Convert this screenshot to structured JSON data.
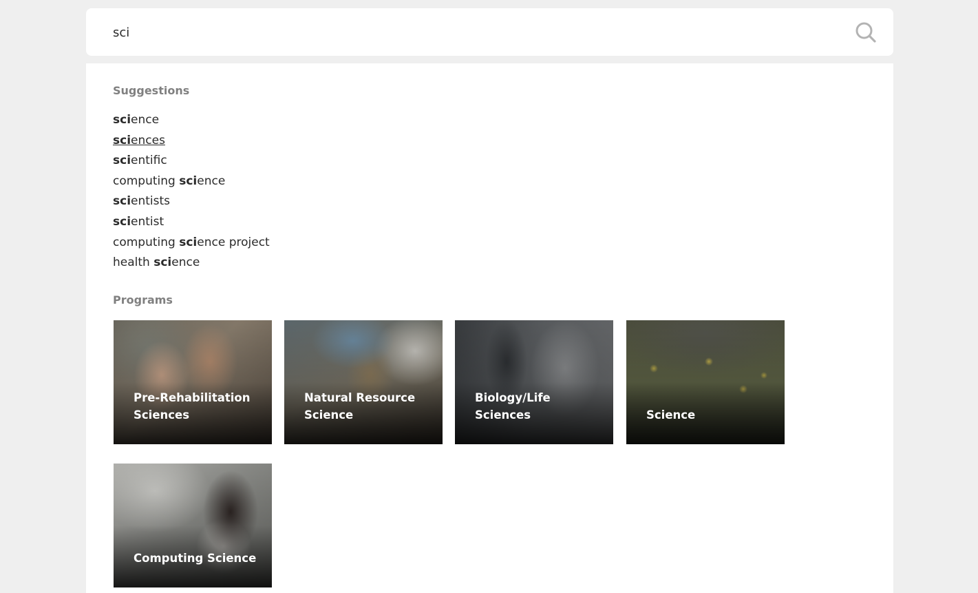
{
  "search": {
    "query": "sci",
    "placeholder": ""
  },
  "suggestions": {
    "heading": "Suggestions",
    "items": [
      {
        "pre": "",
        "match": "sci",
        "post": "ence"
      },
      {
        "pre": "",
        "match": "sci",
        "post": "ences"
      },
      {
        "pre": "",
        "match": "sci",
        "post": "entific"
      },
      {
        "pre": "computing ",
        "match": "sci",
        "post": "ence"
      },
      {
        "pre": "",
        "match": "sci",
        "post": "entists"
      },
      {
        "pre": "",
        "match": "sci",
        "post": "entist"
      },
      {
        "pre": "computing ",
        "match": "sci",
        "post": "ence project"
      },
      {
        "pre": "health ",
        "match": "sci",
        "post": "ence"
      }
    ]
  },
  "programs": {
    "heading": "Programs",
    "items": [
      {
        "title": "Pre-Rehabilitation Sciences"
      },
      {
        "title": "Natural Resource Science"
      },
      {
        "title": "Biology/Life Sciences"
      },
      {
        "title": "Science"
      },
      {
        "title": "Computing Science"
      }
    ]
  },
  "colors": {
    "page_bg": "#efefef",
    "panel_bg": "#ffffff",
    "heading": "#808080",
    "text": "#2b2b2b"
  },
  "icons": {
    "search": "search-icon"
  }
}
